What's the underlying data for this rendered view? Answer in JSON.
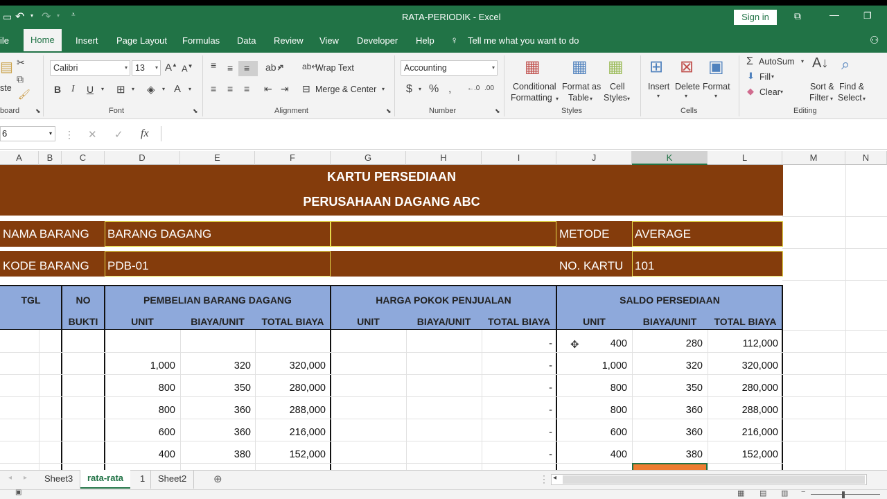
{
  "title_bar": {
    "doc_title": "RATA-PERIODIK  -  Excel",
    "signin_label": "Sign in"
  },
  "tabs": [
    "Home",
    "Insert",
    "Page Layout",
    "Formulas",
    "Data",
    "Review",
    "View",
    "Developer",
    "Help"
  ],
  "tell_me": "Tell me what you want to do",
  "ribbon": {
    "clipboard": {
      "paste_partial": "ste",
      "group_label": "board"
    },
    "font": {
      "name": "Calibri",
      "size": "13",
      "group_label": "Font"
    },
    "alignment": {
      "wrap_text": "Wrap Text",
      "merge_center": "Merge & Center",
      "group_label": "Alignment"
    },
    "number": {
      "format": "Accounting",
      "group_label": "Number"
    },
    "styles": {
      "conditional": "Conditional",
      "formatting": "Formatting",
      "format_as": "Format as",
      "table": "Table",
      "cell": "Cell",
      "styles_btn": "Styles",
      "group_label": "Styles"
    },
    "cells": {
      "insert": "Insert",
      "delete": "Delete",
      "format": "Format",
      "group_label": "Cells"
    },
    "editing": {
      "autosum": "AutoSum",
      "fill": "Fill",
      "clear": "Clear",
      "sort": "Sort &",
      "filter": "Filter",
      "find": "Find &",
      "select": "Select",
      "group_label": "Editing"
    }
  },
  "formula_bar": {
    "name_box": "6",
    "content": ""
  },
  "columns": [
    "A",
    "B",
    "C",
    "D",
    "E",
    "F",
    "G",
    "H",
    "I",
    "J",
    "K",
    "L",
    "M",
    "N"
  ],
  "sheet": {
    "title1": "KARTU PERSEDIAAN",
    "title2": "PERUSAHAAN DAGANG ABC",
    "nama_barang_label": "NAMA BARANG",
    "nama_barang_value": "BARANG DAGANG",
    "metode_label": "METODE",
    "metode_value": "AVERAGE",
    "kode_barang_label": "KODE BARANG",
    "kode_barang_value": "PDB-01",
    "no_kartu_label": "NO. KARTU",
    "no_kartu_value": "101",
    "headers": {
      "tgl": "TGL",
      "no": "NO",
      "bukti": "BUKTI",
      "pembelian": "PEMBELIAN BARANG DAGANG",
      "hpp": "HARGA POKOK PENJUALAN",
      "saldo": "SALDO PERSEDIAAN",
      "unit": "UNIT",
      "biaya_unit": "BIAYA/UNIT",
      "total_biaya": "TOTAL BIAYA"
    },
    "rows": [
      {
        "p_unit": "",
        "p_biaya": "",
        "p_total": "",
        "h_total": "-",
        "s_unit": "400",
        "s_biaya": "280",
        "s_total": "112,000"
      },
      {
        "p_unit": "1,000",
        "p_biaya": "320",
        "p_total": "320,000",
        "h_total": "-",
        "s_unit": "1,000",
        "s_biaya": "320",
        "s_total": "320,000"
      },
      {
        "p_unit": "800",
        "p_biaya": "350",
        "p_total": "280,000",
        "h_total": "-",
        "s_unit": "800",
        "s_biaya": "350",
        "s_total": "280,000"
      },
      {
        "p_unit": "800",
        "p_biaya": "360",
        "p_total": "288,000",
        "h_total": "-",
        "s_unit": "800",
        "s_biaya": "360",
        "s_total": "288,000"
      },
      {
        "p_unit": "600",
        "p_biaya": "360",
        "p_total": "216,000",
        "h_total": "-",
        "s_unit": "600",
        "s_biaya": "360",
        "s_total": "216,000"
      },
      {
        "p_unit": "400",
        "p_biaya": "380",
        "p_total": "152,000",
        "h_total": "-",
        "s_unit": "400",
        "s_biaya": "380",
        "s_total": "152,000"
      }
    ]
  },
  "sheet_tabs": [
    "Sheet3",
    "rata-rata",
    "1",
    "Sheet2"
  ],
  "colors": {
    "excel_green": "#217346",
    "brown": "#843c0c",
    "header_blue": "#8ea9db",
    "highlight_orange": "#ed7d31"
  }
}
